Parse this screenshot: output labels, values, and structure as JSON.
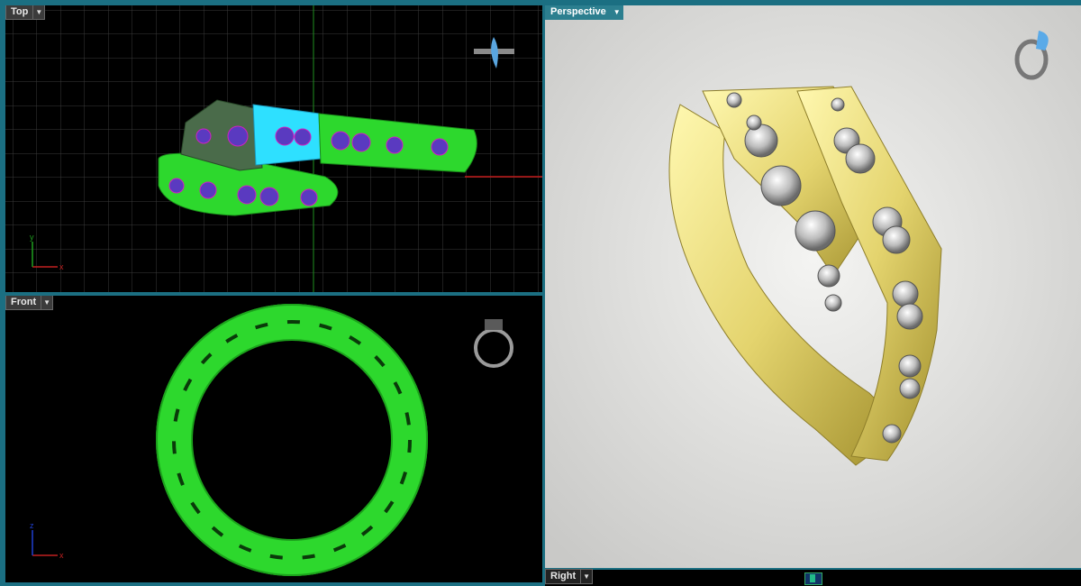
{
  "viewports": {
    "top": {
      "label": "Top",
      "axis_x": "x",
      "axis_y": "y"
    },
    "front": {
      "label": "Front",
      "axis_x": "x",
      "axis_z": "z"
    },
    "perspective": {
      "label": "Perspective"
    },
    "right": {
      "label": "Right"
    }
  },
  "colors": {
    "frame": "#1b6f82",
    "viewport_bg": "#000000",
    "grid": "#3a3a3a",
    "selected_green": "#39ff39",
    "highlight_cyan": "#33ddff",
    "gold": "#e9dc7a",
    "perspective_bg": "#d8d8d6"
  },
  "icons": [
    "arrow-down-icon",
    "ring-preview-icon",
    "axis-gizmo-icon"
  ]
}
